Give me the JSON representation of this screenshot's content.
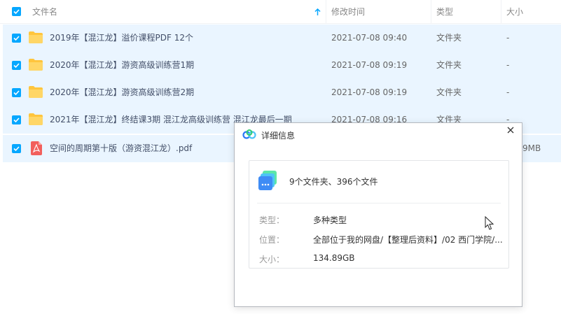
{
  "header": {
    "name_col": "文件名",
    "mtime_col": "修改时间",
    "type_col": "类型",
    "size_col": "大小"
  },
  "rows": [
    {
      "name": "2019年【混江龙】溢价课程PDF 12个",
      "mtime": "2021-07-08 09:40",
      "type": "文件夹",
      "size": "-",
      "icon": "folder-icon"
    },
    {
      "name": "2020年【混江龙】游资高级训练营1期",
      "mtime": "2021-07-08 09:19",
      "type": "文件夹",
      "size": "-",
      "icon": "folder-icon"
    },
    {
      "name": "2020年【混江龙】游资高级训练营2期",
      "mtime": "2021-07-08 09:19",
      "type": "文件夹",
      "size": "-",
      "icon": "folder-icon"
    },
    {
      "name": "2021年【混江龙】终结课3期 混江龙高级训练营 混江龙最后一期",
      "mtime": "2021-07-08 09:16",
      "type": "文件夹",
      "size": "-",
      "icon": "folder-icon"
    },
    {
      "name": "空间的周期第十版（游资混江龙）.pdf",
      "mtime": "",
      "type": "",
      "size": "9MB",
      "icon": "pdf-icon"
    }
  ],
  "dialog": {
    "title": "详细信息",
    "summary": "9个文件夹、396个文件",
    "type_label": "类型：",
    "type_value": "多种类型",
    "location_label": "位置：",
    "location_value": "全部位于我的网盘/【整理后资料】/02 西门学院/...",
    "size_label": "大小：",
    "size_value": "134.89GB"
  },
  "colors": {
    "accent": "#06a7ff",
    "row_selected": "#eaf5ff",
    "folder": "#ffc53d",
    "pdf": "#f25f5c"
  }
}
